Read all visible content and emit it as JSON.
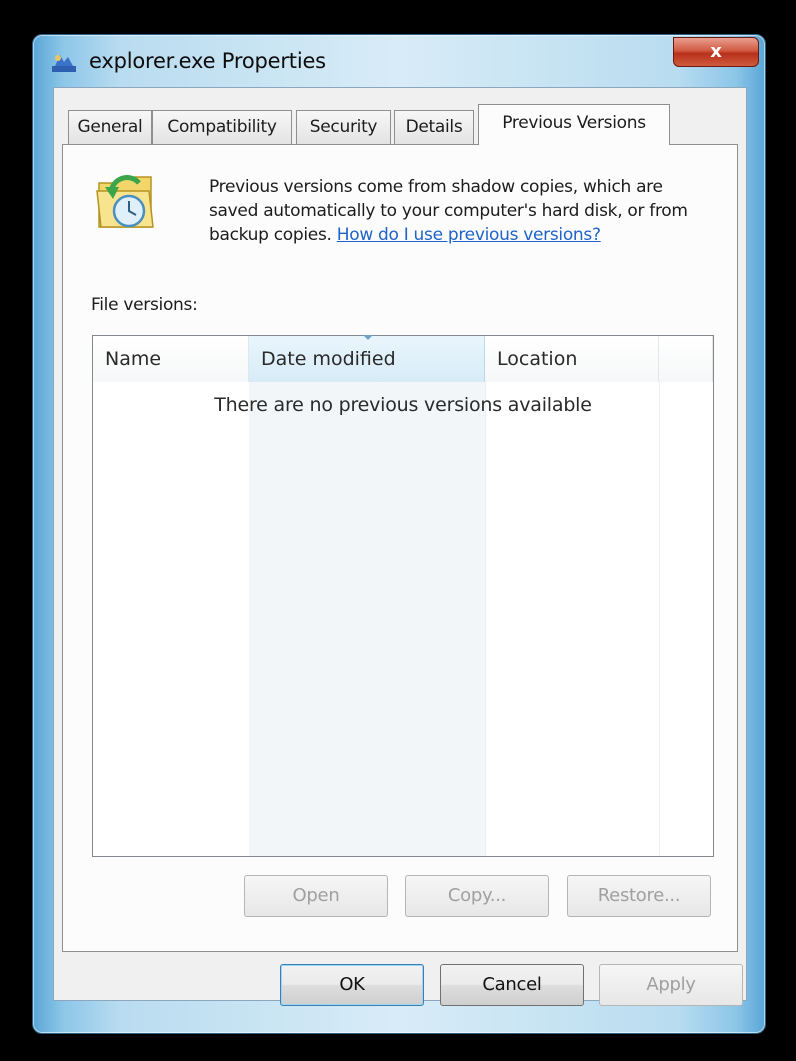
{
  "window": {
    "title": "explorer.exe Properties",
    "close_label": "x"
  },
  "tabs": [
    {
      "label": "General",
      "active": false
    },
    {
      "label": "Compatibility",
      "active": false
    },
    {
      "label": "Security",
      "active": false
    },
    {
      "label": "Details",
      "active": false
    },
    {
      "label": "Previous Versions",
      "active": true
    }
  ],
  "panel": {
    "description": "Previous versions come from shadow copies, which are saved automatically to your computer's hard disk, or from backup copies.",
    "help_link": "How do I use previous versions?",
    "file_versions_label": "File versions:",
    "list": {
      "columns": [
        "Name",
        "Date modified",
        "Location"
      ],
      "sorted_column": "Date modified",
      "empty_message": "There are no previous versions available"
    },
    "buttons": {
      "open": "Open",
      "copy": "Copy...",
      "restore": "Restore..."
    }
  },
  "footer": {
    "ok": "OK",
    "cancel": "Cancel",
    "apply": "Apply"
  },
  "colors": {
    "link": "#1f62c8",
    "close_button": "#c8432a",
    "frame": "#b9dcf0"
  }
}
